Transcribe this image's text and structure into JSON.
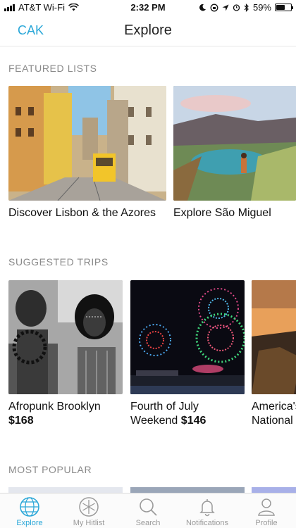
{
  "status_bar": {
    "carrier": "AT&T Wi-Fi",
    "time": "2:32 PM",
    "battery": "59%",
    "battery_level": 0.59
  },
  "nav": {
    "left_label": "CAK",
    "title": "Explore"
  },
  "featured": {
    "header": "FEATURED LISTS",
    "items": [
      {
        "title": "Discover Lisbon & the Azores"
      },
      {
        "title": "Explore São Miguel"
      }
    ]
  },
  "suggested": {
    "header": "SUGGESTED TRIPS",
    "items": [
      {
        "line1": "Afropunk Brooklyn",
        "line2_prefix": "",
        "price": "$168"
      },
      {
        "line1": "Fourth of July",
        "line2_prefix": "Weekend",
        "price": "$146"
      },
      {
        "line1": "America's",
        "line2_prefix": "National",
        "price": ""
      }
    ]
  },
  "popular": {
    "header": "MOST POPULAR"
  },
  "tabs": [
    {
      "label": "Explore",
      "icon": "globe-icon",
      "active": true
    },
    {
      "label": "My Hitlist",
      "icon": "snowflake-icon",
      "active": false
    },
    {
      "label": "Search",
      "icon": "search-icon",
      "active": false
    },
    {
      "label": "Notifications",
      "icon": "bell-icon",
      "active": false
    },
    {
      "label": "Profile",
      "icon": "person-icon",
      "active": false
    }
  ],
  "colors": {
    "accent": "#2aa7d8",
    "section_header": "#8a8a8a",
    "tab_inactive": "#9a9a9a"
  }
}
